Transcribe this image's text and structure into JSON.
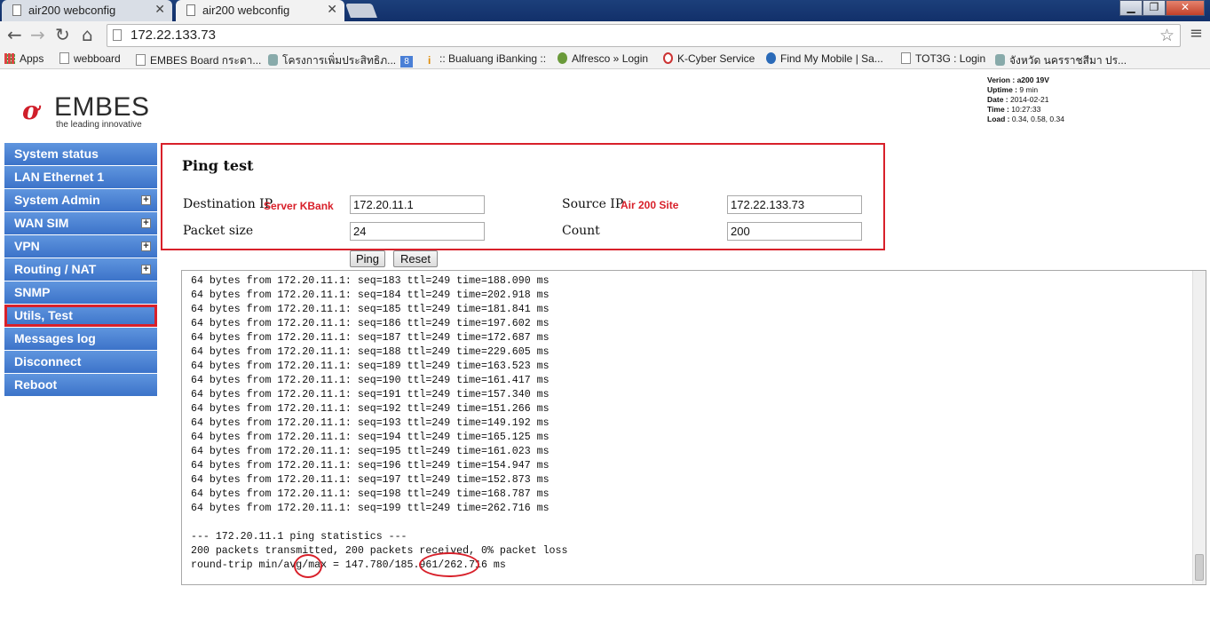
{
  "browser": {
    "tabs": [
      {
        "label": "air200 webconfig",
        "active": false
      },
      {
        "label": "air200 webconfig",
        "active": true
      }
    ],
    "url": "172.22.133.73",
    "bookmarks": [
      "Apps",
      "webboard",
      "EMBES Board กระดา...",
      "โครงการเพิ่มประสิทธิภ...",
      "",
      ":: Bualuang iBanking ::",
      "Alfresco » Login",
      "K-Cyber Service",
      "Find My Mobile | Sa...",
      "TOT3G : Login",
      "จังหวัด นครราชสีมา ปร..."
    ]
  },
  "logo": {
    "name": "EMBES",
    "tagline": "the leading innovative"
  },
  "status_info": {
    "version_label": "Verion :",
    "version": "a200 19V",
    "uptime_label": "Uptime :",
    "uptime": "9 min",
    "date_label": "Date :",
    "date": "2014-02-21",
    "time_label": "Time :",
    "time": "10:27:33",
    "load_label": "Load :",
    "load": "0.34, 0.58, 0.34"
  },
  "menu": {
    "items": [
      {
        "label": "System status",
        "expandable": false
      },
      {
        "label": "LAN Ethernet 1",
        "expandable": false
      },
      {
        "label": "System Admin",
        "expandable": true
      },
      {
        "label": "WAN SIM",
        "expandable": true
      },
      {
        "label": "VPN",
        "expandable": true
      },
      {
        "label": "Routing / NAT",
        "expandable": true
      },
      {
        "label": "SNMP",
        "expandable": false
      },
      {
        "label": "Utils, Test",
        "expandable": false,
        "highlighted": true
      },
      {
        "label": "Messages log",
        "expandable": false
      },
      {
        "label": "Disconnect",
        "expandable": false
      },
      {
        "label": "Reboot",
        "expandable": false
      }
    ]
  },
  "ping_form": {
    "title": "Ping test",
    "destination_label": "Destination IP",
    "destination_note": "Server KBank",
    "destination_value": "172.20.11.1",
    "source_label": "Source IP",
    "source_note": "Air 200 Site",
    "source_value": "172.22.133.73",
    "packet_size_label": "Packet size",
    "packet_size_value": "24",
    "count_label": "Count",
    "count_value": "200",
    "ping_button": "Ping",
    "reset_button": "Reset"
  },
  "output": {
    "lines": [
      "64 bytes from 172.20.11.1: seq=183 ttl=249 time=188.090 ms",
      "64 bytes from 172.20.11.1: seq=184 ttl=249 time=202.918 ms",
      "64 bytes from 172.20.11.1: seq=185 ttl=249 time=181.841 ms",
      "64 bytes from 172.20.11.1: seq=186 ttl=249 time=197.602 ms",
      "64 bytes from 172.20.11.1: seq=187 ttl=249 time=172.687 ms",
      "64 bytes from 172.20.11.1: seq=188 ttl=249 time=229.605 ms",
      "64 bytes from 172.20.11.1: seq=189 ttl=249 time=163.523 ms",
      "64 bytes from 172.20.11.1: seq=190 ttl=249 time=161.417 ms",
      "64 bytes from 172.20.11.1: seq=191 ttl=249 time=157.340 ms",
      "64 bytes from 172.20.11.1: seq=192 ttl=249 time=151.266 ms",
      "64 bytes from 172.20.11.1: seq=193 ttl=249 time=149.192 ms",
      "64 bytes from 172.20.11.1: seq=194 ttl=249 time=165.125 ms",
      "64 bytes from 172.20.11.1: seq=195 ttl=249 time=161.023 ms",
      "64 bytes from 172.20.11.1: seq=196 ttl=249 time=154.947 ms",
      "64 bytes from 172.20.11.1: seq=197 ttl=249 time=152.873 ms",
      "64 bytes from 172.20.11.1: seq=198 ttl=249 time=168.787 ms",
      "64 bytes from 172.20.11.1: seq=199 ttl=249 time=262.716 ms",
      "",
      "--- 172.20.11.1 ping statistics ---",
      "200 packets transmitted, 200 packets received, 0% packet loss",
      "round-trip min/avg/max = 147.780/185.961/262.716 ms"
    ]
  },
  "colors": {
    "menu": "#3c73c9",
    "highlight": "#d8202a",
    "logo_red": "#d01e2a"
  }
}
